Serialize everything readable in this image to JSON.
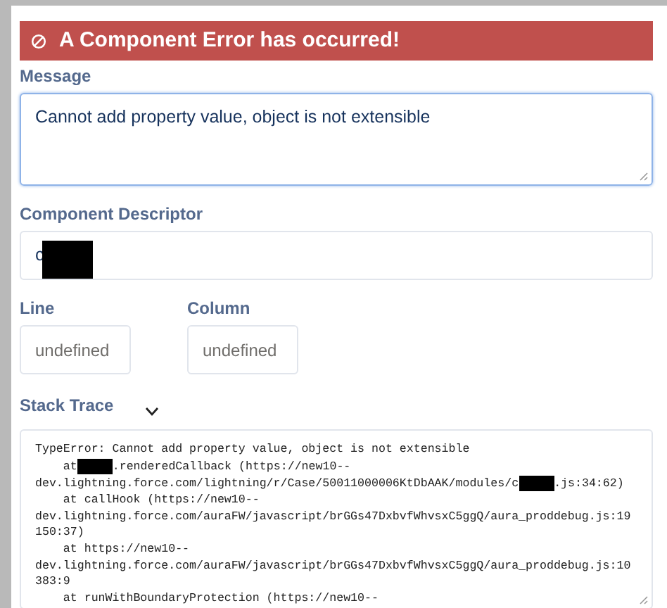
{
  "header": {
    "title": "A Component Error has occurred!"
  },
  "message": {
    "label": "Message",
    "value": "Cannot add property value, object is not extensible",
    "focused": true
  },
  "descriptor": {
    "label": "Component Descriptor",
    "value": "c"
  },
  "line": {
    "label": "Line",
    "value": "undefined"
  },
  "column": {
    "label": "Column",
    "value": "undefined"
  },
  "stack_trace": {
    "label": "Stack Trace",
    "expanded": true,
    "lines": [
      {
        "parts": [
          {
            "kind": "text",
            "text": "TypeError: Cannot add property value, object is not extensible"
          }
        ]
      },
      {
        "parts": [
          {
            "kind": "text",
            "text": "    at"
          },
          {
            "kind": "redacted"
          },
          {
            "kind": "text",
            "text": ".renderedCallback (https://new10--"
          }
        ]
      },
      {
        "parts": [
          {
            "kind": "text",
            "text": "dev.lightning.force.com/lightning/r/Case/50011000006KtDbAAK/modules/c"
          },
          {
            "kind": "redacted"
          },
          {
            "kind": "text",
            "text": ".js:34:62)"
          }
        ]
      },
      {
        "parts": [
          {
            "kind": "text",
            "text": "    at callHook (https://new10--"
          }
        ]
      },
      {
        "parts": [
          {
            "kind": "text",
            "text": "dev.lightning.force.com/auraFW/javascript/brGGs47DxbvfWhvsxC5ggQ/aura_proddebug.js:19"
          }
        ]
      },
      {
        "parts": [
          {
            "kind": "text",
            "text": "150:37)"
          }
        ]
      },
      {
        "parts": [
          {
            "kind": "text",
            "text": "    at https://new10--"
          }
        ]
      },
      {
        "parts": [
          {
            "kind": "text",
            "text": "dev.lightning.force.com/auraFW/javascript/brGGs47DxbvfWhvsxC5ggQ/aura_proddebug.js:10"
          }
        ]
      },
      {
        "parts": [
          {
            "kind": "text",
            "text": "383:9"
          }
        ]
      },
      {
        "parts": [
          {
            "kind": "text",
            "text": "    at runWithBoundaryProtection (https://new10--"
          }
        ]
      }
    ]
  }
}
